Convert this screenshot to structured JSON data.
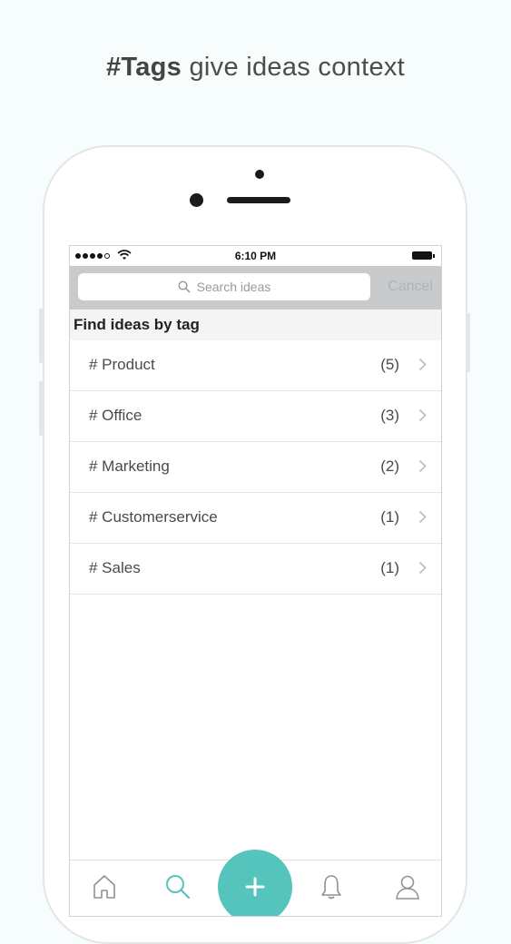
{
  "headline": {
    "bold": "#Tags",
    "rest": " give ideas context"
  },
  "status_bar": {
    "time": "6:10 PM"
  },
  "search": {
    "placeholder": "Search ideas",
    "cancel_label": "Cancel"
  },
  "section_title": "Find ideas by tag",
  "tags": [
    {
      "label": "# Product",
      "count": "(5)"
    },
    {
      "label": "# Office",
      "count": "(3)"
    },
    {
      "label": "# Marketing",
      "count": "(2)"
    },
    {
      "label": "# Customerservice",
      "count": "(1)"
    },
    {
      "label": "# Sales",
      "count": "(1)"
    }
  ],
  "tab_bar": {
    "items": [
      "home-icon",
      "search-icon",
      "add-icon",
      "bell-icon",
      "profile-icon"
    ],
    "active": "search-icon"
  },
  "colors": {
    "accent": "#55c4bd",
    "searchbar_bg": "#c9cacc"
  }
}
